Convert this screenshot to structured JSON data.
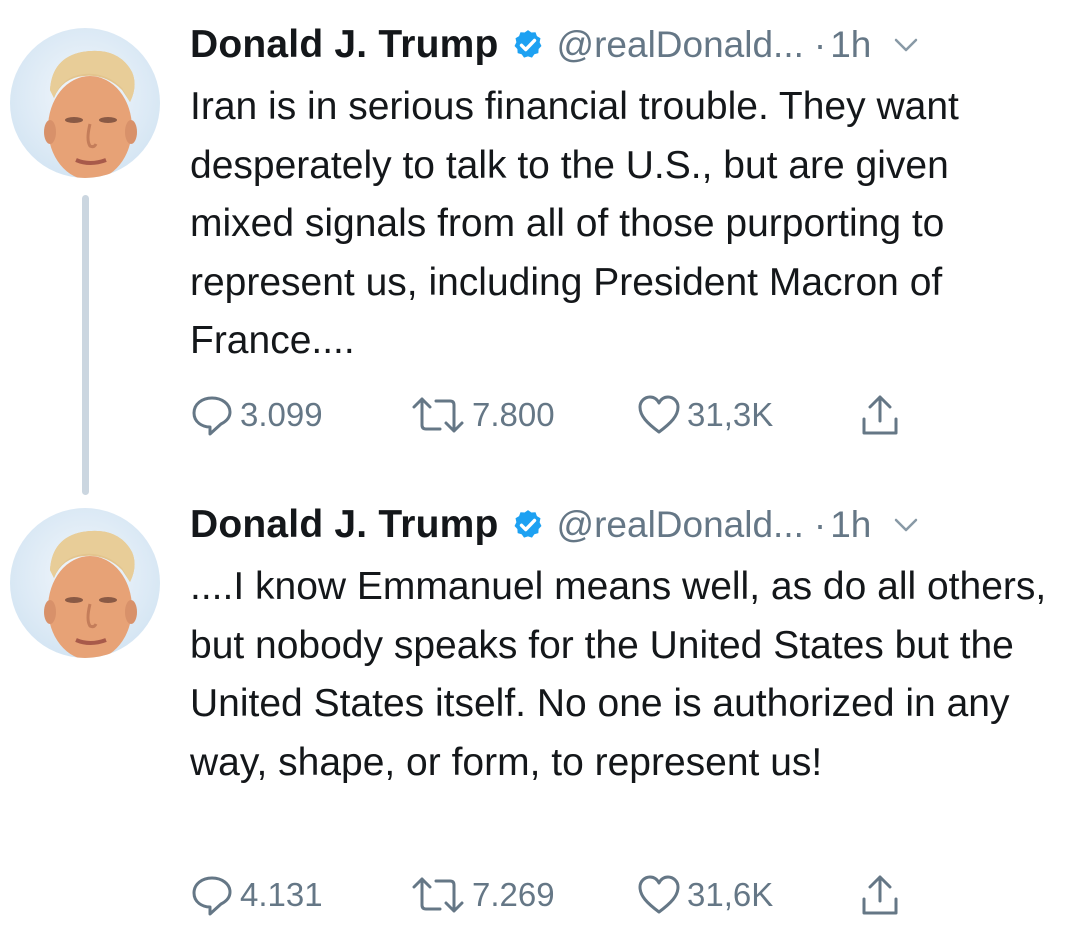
{
  "tweets": [
    {
      "author_name": "Donald J. Trump",
      "handle": "@realDonald...",
      "separator": "·",
      "time": "1h",
      "text": "Iran is in serious financial trouble. They want desperately to talk to the U.S., but are given mixed signals from all of those purporting to represent us, including President Macron of France....",
      "reply_count": "3.099",
      "retweet_count": "7.800",
      "like_count": "31,3K"
    },
    {
      "author_name": "Donald J. Trump",
      "handle": "@realDonald...",
      "separator": "·",
      "time": "1h",
      "text": "....I know Emmanuel means well, as do all others, but nobody speaks for the United States but the United States itself. No one is authorized in any way, shape, or form, to represent us!",
      "reply_count": "4.131",
      "retweet_count": "7.269",
      "like_count": "31,6K"
    }
  ],
  "icons": {
    "verified": "verified-badge-icon",
    "menu": "chevron-down-icon",
    "reply": "reply-icon",
    "retweet": "retweet-icon",
    "like": "heart-icon",
    "share": "share-icon"
  },
  "colors": {
    "verified_blue": "#1da1f2",
    "secondary_text": "#657786",
    "primary_text": "#14171a",
    "thread_line": "#cbd6e0"
  }
}
